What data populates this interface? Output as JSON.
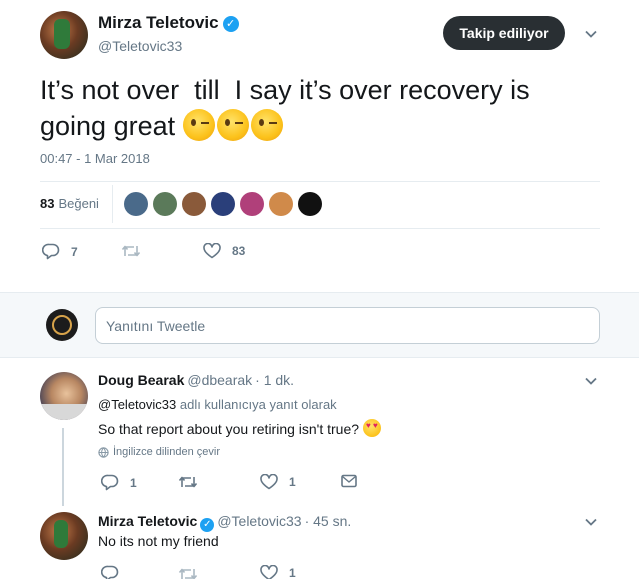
{
  "main_tweet": {
    "author_name": "Mirza Teletovic",
    "author_handle": "@Teletovic33",
    "follow_button_label": "Takip ediliyor",
    "text": "It’s not over  till  I say it’s over recovery is going great ",
    "emoji": "winking-face-emoji",
    "timestamp": "00:47 - 1 Mar 2018",
    "likes_number": "83",
    "likes_label": "Beğeni",
    "likers": [
      {
        "name": "liker-1",
        "color": "#4a6a8a"
      },
      {
        "name": "liker-2",
        "color": "#5b7a5a"
      },
      {
        "name": "liker-3",
        "color": "#8a5a3a"
      },
      {
        "name": "liker-4",
        "color": "#2a3f7a"
      },
      {
        "name": "liker-5",
        "color": "#b0407a"
      },
      {
        "name": "liker-6",
        "color": "#d08a4a"
      },
      {
        "name": "liker-7",
        "color": "#111111"
      }
    ],
    "reply_count": "7",
    "retweet_count": "",
    "like_count": "83"
  },
  "reply_box": {
    "placeholder": "Yanıtını Tweetle"
  },
  "replies": [
    {
      "author_name": "Doug Bearak",
      "author_handle": "@dbearak",
      "time": "· 1 dk.",
      "replying_to_handle": "@Teletovic33",
      "replying_to_suffix": " adlı kullanıcıya yanıt olarak",
      "text": "So that report about you retiring isn't true?",
      "emoji": "heart-eyes-emoji",
      "translate_label": "İngilizce dilinden çevir",
      "reply_count": "1",
      "retweet_count": "",
      "like_count": "1"
    },
    {
      "author_name": "Mirza Teletovic",
      "author_handle": "@Teletovic33",
      "time": "· 45 sn.",
      "text": "No its not my friend",
      "reply_count": "",
      "retweet_count": "",
      "like_count": "1"
    }
  ],
  "colors": {
    "accent": "#1da1f2",
    "muted": "#657786",
    "button_dark": "#292f33",
    "divider": "#e6ecf0"
  }
}
